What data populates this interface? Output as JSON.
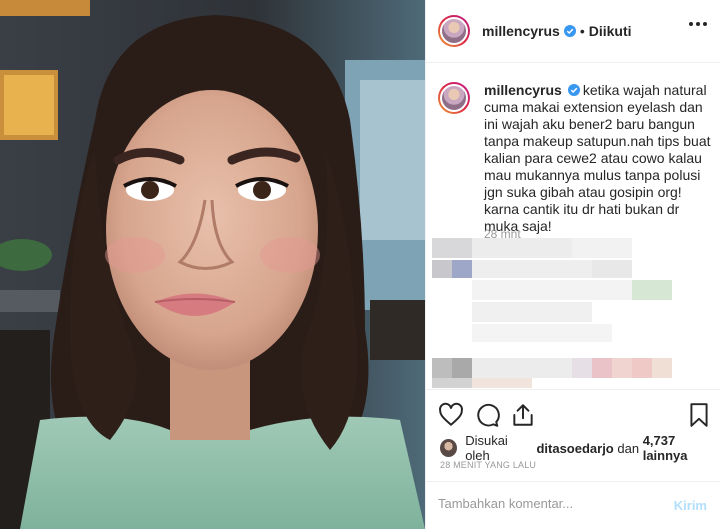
{
  "post": {
    "image_alt": "selfie portrait",
    "header": {
      "username": "millencyrus",
      "separator": "•",
      "follow_label": "Diikuti"
    },
    "caption": {
      "username": "millencyrus",
      "text": "ketika wajah natural cuma makai extension eyelash dan ini wajah aku bener2 baru bangun tanpa makeup satupun.nah tips buat kalian para cewe2 atau cowo kalau mau mukannya mulus tanpa polusi jgn suka gibah atau gosipin org! karna cantik itu dr hati bukan dr muka saja!",
      "time": "28 mnt"
    },
    "likes": {
      "prefix": "Disukai oleh",
      "first_user": "ditasoedarjo",
      "joiner": "dan",
      "others": "4,737 lainnya"
    },
    "timestamp": "28 MENIT YANG LALU",
    "comment": {
      "placeholder": "Tambahkan komentar...",
      "post_label": "Kirim"
    },
    "icons": {
      "verified": "verified-badge-icon",
      "more": "more-options-icon",
      "like": "heart-icon",
      "comment": "comment-bubble-icon",
      "share": "share-icon",
      "save": "bookmark-icon"
    },
    "colors": {
      "verified": "#3897f0",
      "post_button": "#b2dffc",
      "muted_text": "#999999"
    }
  }
}
